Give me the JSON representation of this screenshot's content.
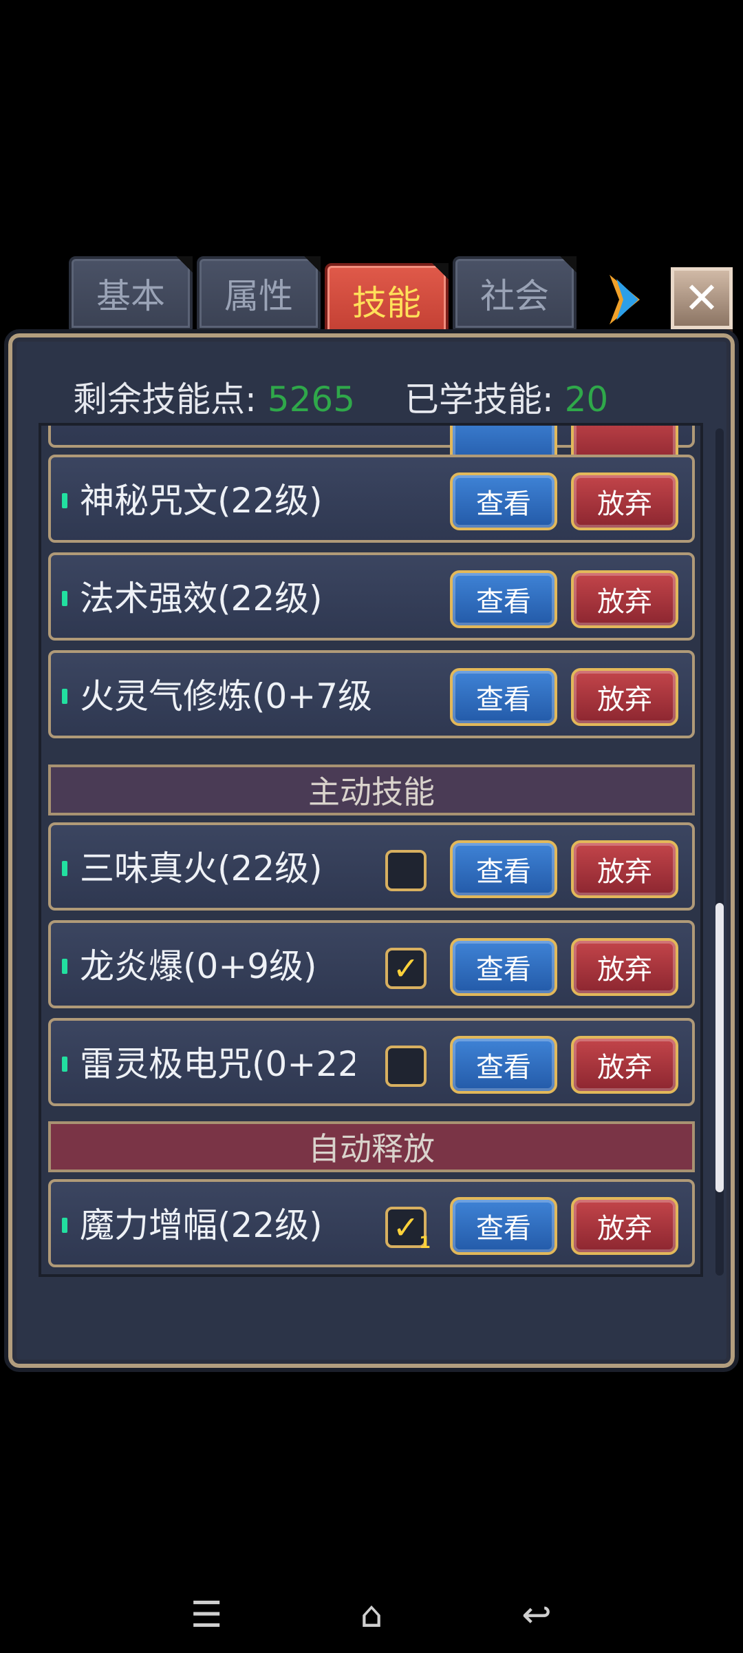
{
  "tabs": [
    {
      "label": "基本",
      "active": false
    },
    {
      "label": "属性",
      "active": false
    },
    {
      "label": "技能",
      "active": true
    },
    {
      "label": "社会",
      "active": false
    }
  ],
  "header": {
    "close_icon": "close-icon",
    "next_icon": "arrow-right-icon"
  },
  "stats": {
    "remaining_label": "剩余技能点:",
    "remaining_value": "5265",
    "learned_label": "已学技能:",
    "learned_value": "20"
  },
  "passive_rows": [
    {
      "name": "神秘咒文(22级)",
      "view": "查看",
      "quit": "放弃"
    },
    {
      "name": "法术强效(22级)",
      "view": "查看",
      "quit": "放弃"
    },
    {
      "name": "火灵气修炼(0+7级",
      "view": "查看",
      "quit": "放弃"
    }
  ],
  "active_section": "主动技能",
  "active_rows": [
    {
      "name": "三味真火(22级)",
      "checked": false,
      "view": "查看",
      "quit": "放弃"
    },
    {
      "name": "龙炎爆(0+9级)",
      "checked": true,
      "view": "查看",
      "quit": "放弃"
    },
    {
      "name": "雷灵极电咒(0+22",
      "checked": false,
      "view": "查看",
      "quit": "放弃"
    }
  ],
  "auto_section": "自动释放",
  "auto_rows": [
    {
      "name": "魔力增幅(22级)",
      "checked": true,
      "order": "1",
      "view": "查看",
      "quit": "放弃"
    }
  ],
  "check_mark": "✓",
  "scroll_position": 0.85,
  "colors": {
    "accent_green": "#2fa84a",
    "active_tab": "#c23f33",
    "view_button": "#235aa8",
    "quit_button": "#8c2630"
  }
}
